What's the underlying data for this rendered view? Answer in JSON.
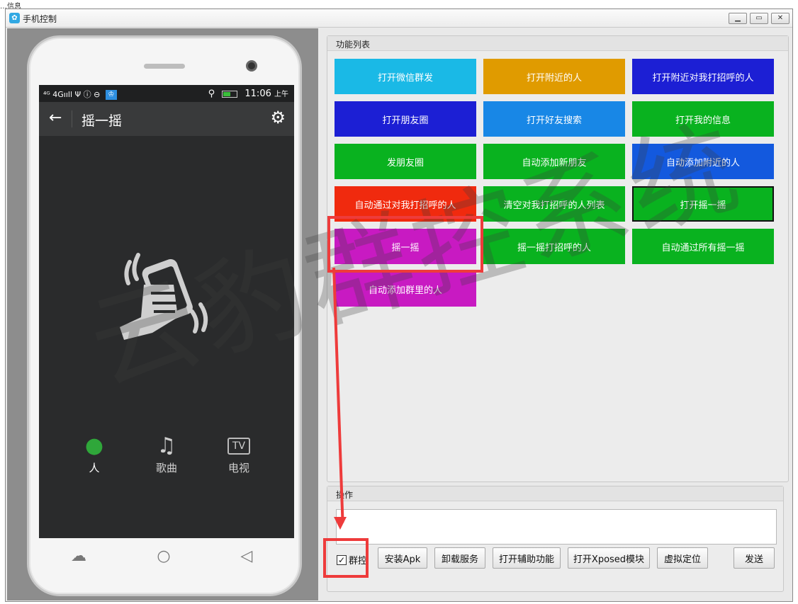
{
  "window": {
    "title": "手机控制",
    "minimize_icon": "minimize-icon",
    "restore_icon": "restore-icon",
    "close_icon": "close-icon",
    "top_strip_text": "…信息"
  },
  "phone": {
    "statusbar": {
      "left_text": "⁴ᴳ 4Gııll  Ψ  ⓘ  ⊖",
      "time": "11:06",
      "time_suffix": "上午"
    },
    "appbar": {
      "title": "摇一摇"
    },
    "tabs": [
      {
        "label": "人",
        "icon": "person-icon"
      },
      {
        "label": "歌曲",
        "icon": "music-icon"
      },
      {
        "label": "电视",
        "icon": "tv-icon"
      }
    ]
  },
  "functions": {
    "title": "功能列表",
    "buttons": [
      {
        "label": "打开微信群发",
        "color": "#1ab9e6"
      },
      {
        "label": "打开附近的人",
        "color": "#e09b00"
      },
      {
        "label": "打开附近对我打招呼的人",
        "color": "#1c1fd4"
      },
      {
        "label": "打开朋友圈",
        "color": "#1c1fd4"
      },
      {
        "label": "打开好友搜索",
        "color": "#1887e6"
      },
      {
        "label": "打开我的信息",
        "color": "#09b21f"
      },
      {
        "label": "发朋友圈",
        "color": "#09b21f"
      },
      {
        "label": "自动添加新朋友",
        "color": "#09b21f"
      },
      {
        "label": "自动添加附近的人",
        "color": "#1359de"
      },
      {
        "label": "自动通过对我打招呼的人",
        "color": "#f02a0e"
      },
      {
        "label": "清空对我打招呼的人列表",
        "color": "#09b21f"
      },
      {
        "label": "打开摇一摇",
        "color": "#09b21f"
      },
      {
        "label": "摇一摇",
        "color": "#c81ac2"
      },
      {
        "label": "摇一摇打招呼的人",
        "color": "#09b21f"
      },
      {
        "label": "自动通过所有摇一摇",
        "color": "#09b21f"
      },
      {
        "label": "自动添加群里的人",
        "color": "#c81ac2"
      }
    ]
  },
  "operations": {
    "title": "操作",
    "input_value": "",
    "group_control_label": "群控",
    "group_control_checked": true,
    "buttons": [
      {
        "label": "安装Apk"
      },
      {
        "label": "卸载服务"
      },
      {
        "label": "打开辅助功能"
      },
      {
        "label": "打开Xposed模块"
      },
      {
        "label": "虚拟定位"
      },
      {
        "label": "发送"
      }
    ]
  },
  "watermark": "云豹群控系统"
}
